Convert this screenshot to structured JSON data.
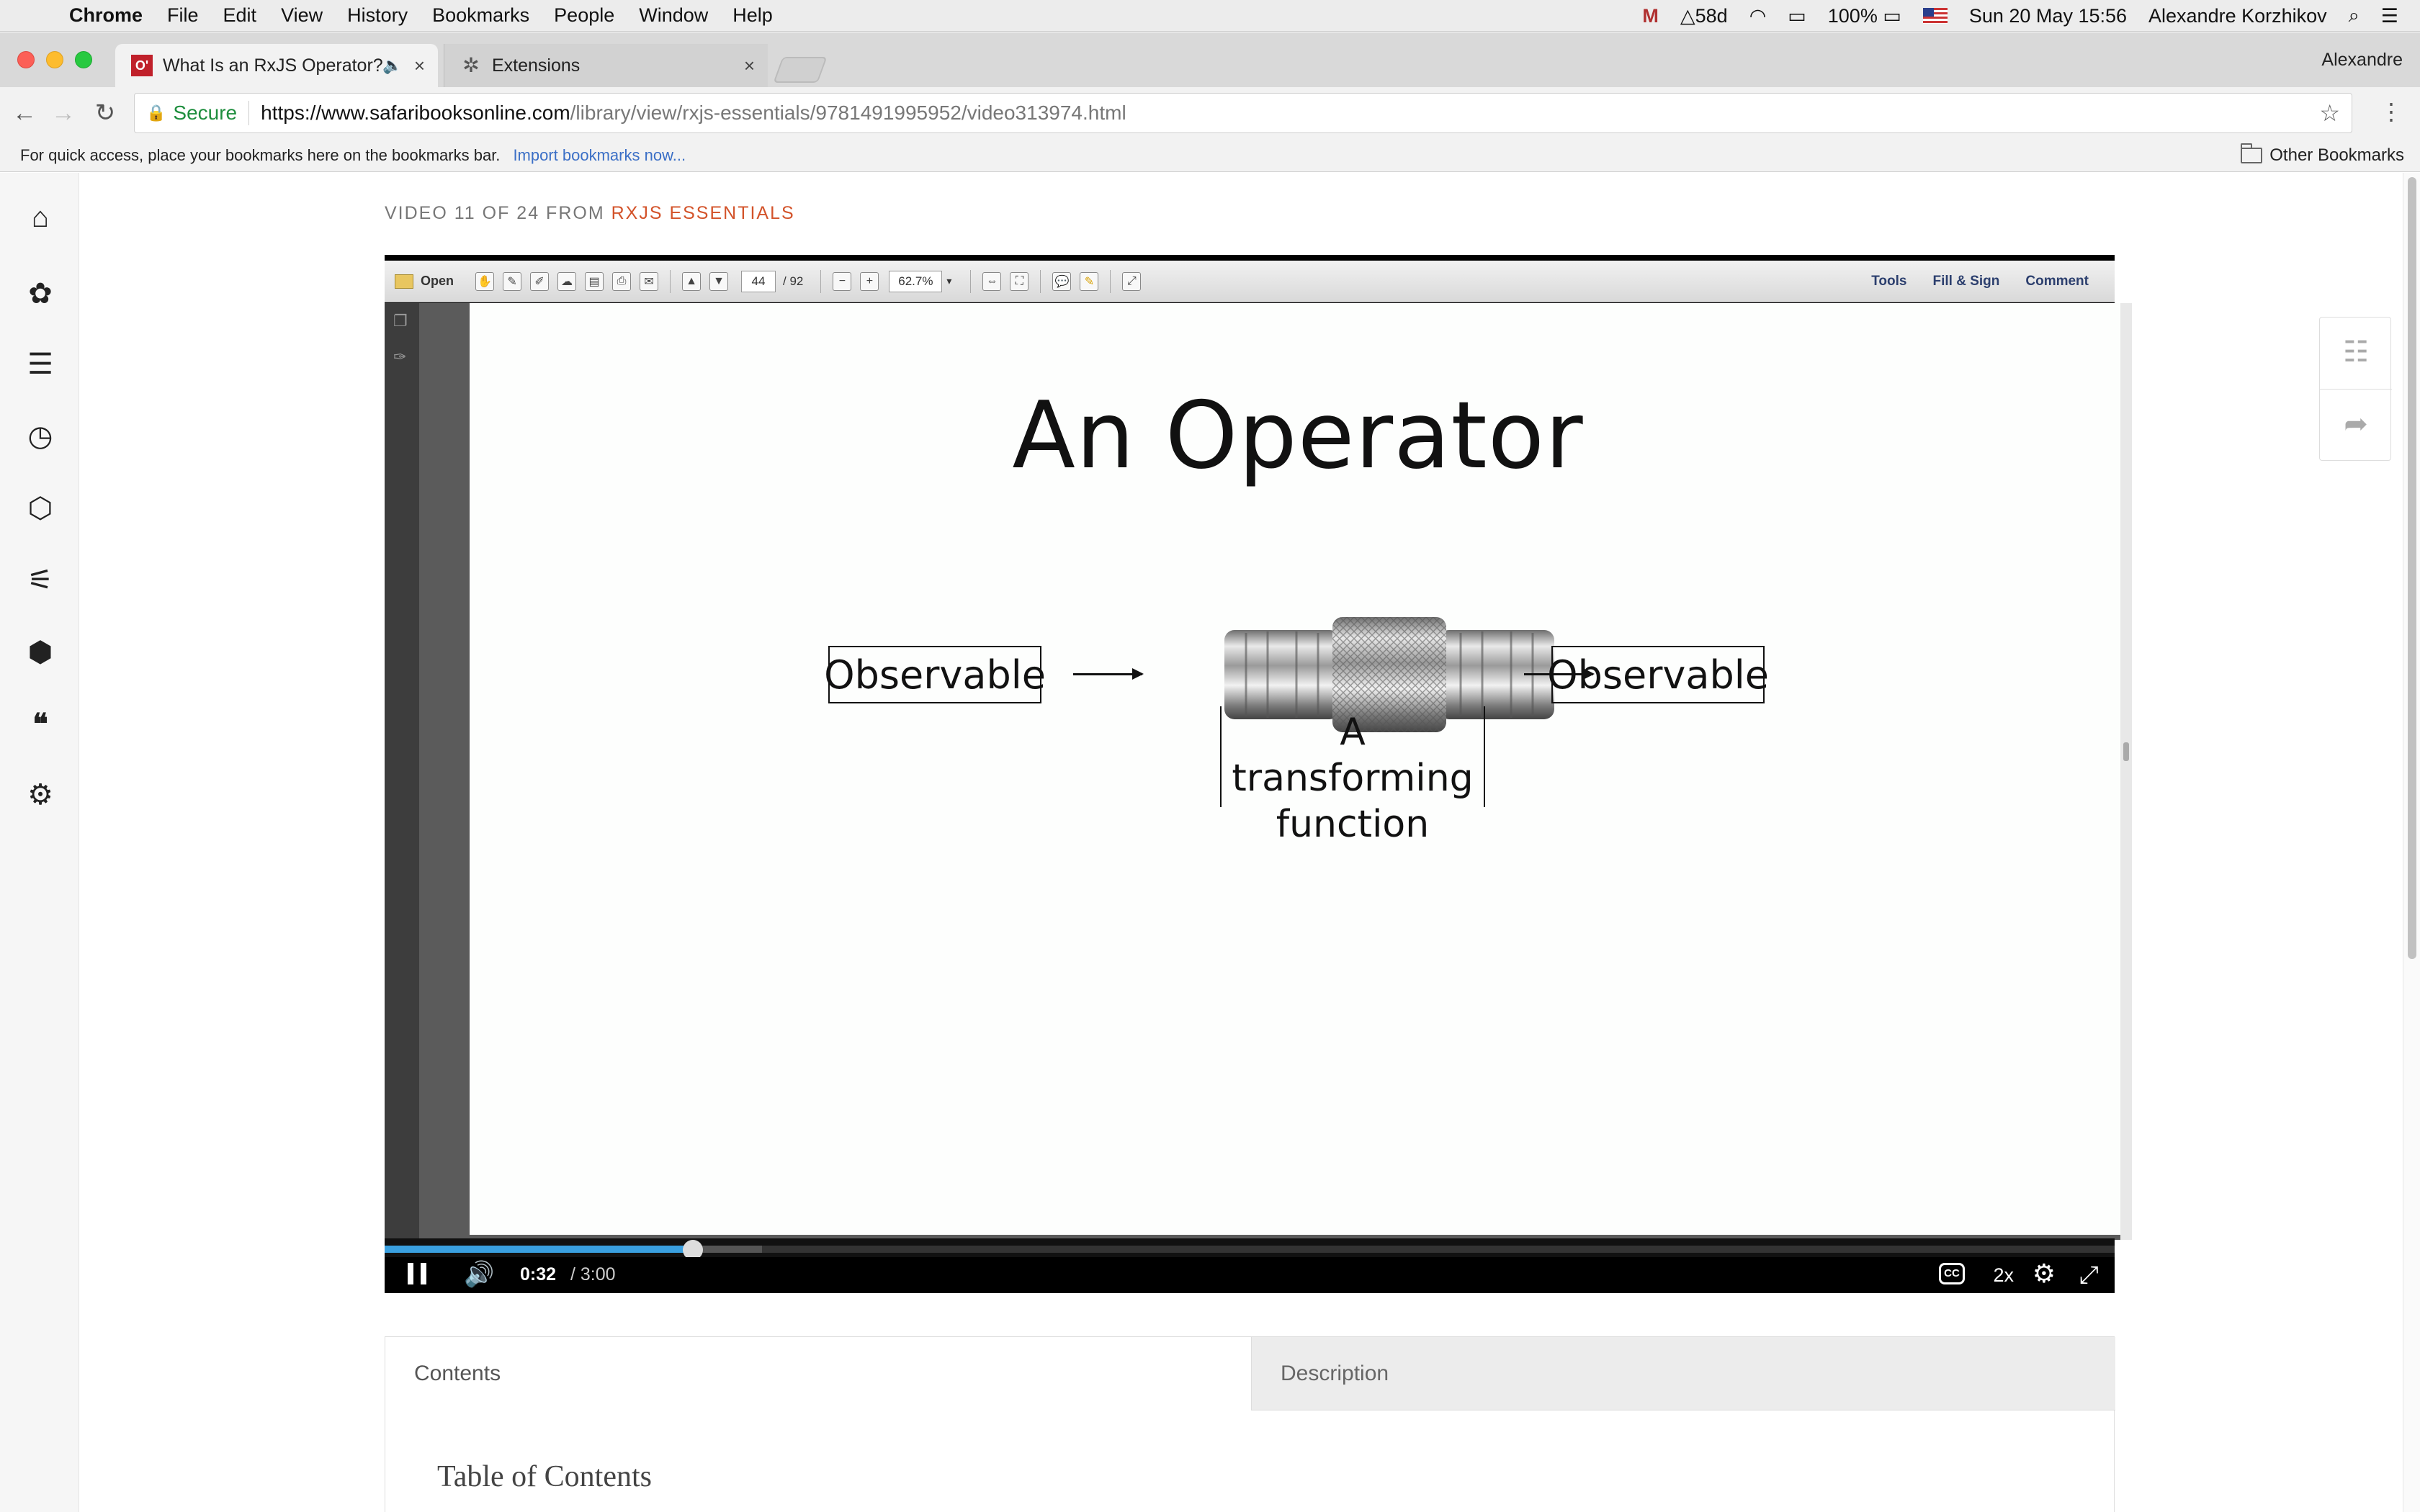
{
  "menubar": {
    "app": "Chrome",
    "items": [
      "File",
      "Edit",
      "View",
      "History",
      "Bookmarks",
      "People",
      "Window",
      "Help"
    ],
    "status": {
      "days_counter": "58d",
      "battery": "100%",
      "datetime": "Sun 20 May  15:56",
      "user": "Alexandre Korzhikov"
    }
  },
  "tabs": [
    {
      "title": "What Is an RxJS Operator?",
      "favicon": "oreilly-logo-icon",
      "active": true,
      "audio": true
    },
    {
      "title": "Extensions",
      "favicon": "puzzle-piece-icon",
      "active": false,
      "audio": false
    }
  ],
  "profile_name": "Alexandre",
  "omnibox": {
    "secure_label": "Secure",
    "url_host": "https://www.safaribooksonline.com",
    "url_path": "/library/view/rxjs-essentials/9781491995952/video313974.html"
  },
  "bookmarks_bar": {
    "hint": "For quick access, place your bookmarks here on the bookmarks bar.",
    "import_link": "Import bookmarks now...",
    "other": "Other Bookmarks"
  },
  "rail_icons": [
    "home-icon",
    "topics-icon",
    "playlist-icon",
    "history-icon",
    "hexagon-icon",
    "learning-paths-icon",
    "cube-icon",
    "highlights-quote-icon",
    "settings-gear-icon"
  ],
  "breadcrumb": {
    "prefix": "VIDEO 11 OF 24 FROM",
    "link": "RXJS ESSENTIALS"
  },
  "pdf_toolbar": {
    "open_label": "Open",
    "page_current": "44",
    "page_total": "/ 92",
    "zoom": "62.7%",
    "right_tools": [
      "Tools",
      "Fill & Sign",
      "Comment"
    ]
  },
  "slide": {
    "title": "An Operator",
    "left_box": "Observable",
    "right_box": "Observable",
    "function_label_line1": "A transforming",
    "function_label_line2": "function"
  },
  "player": {
    "current_time": "0:32",
    "duration": "/ 3:00",
    "played_fraction": 0.178,
    "buffered_fraction": 0.218,
    "speed": "2x",
    "cc": "CC"
  },
  "content_tabs": {
    "contents": "Contents",
    "description": "Description",
    "toc_heading": "Table of Contents"
  }
}
